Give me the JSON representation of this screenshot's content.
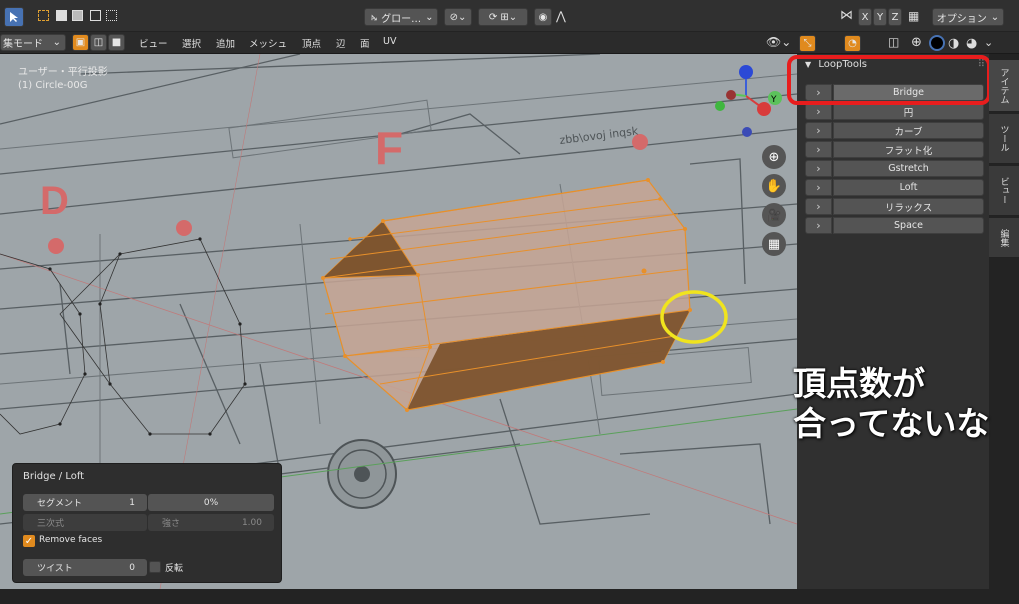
{
  "header": {
    "orientation_label": "グロー…",
    "options_label": "オプション",
    "axes": [
      "X",
      "Y",
      "Z"
    ]
  },
  "secondary": {
    "mode_label": "集モード",
    "menus": [
      "ビュー",
      "選択",
      "追加",
      "メッシュ",
      "頂点",
      "辺",
      "面",
      "UV"
    ]
  },
  "viewport": {
    "view_name": "ユーザー・平行投影",
    "object_name": "(1) Circle-00G",
    "bg_letters": [
      "D",
      "F"
    ],
    "blueprint_text": "zbb\\ovoj inqsk",
    "gizmo_labels": [
      "Y",
      "Z"
    ]
  },
  "sidebar": {
    "panel_title": "LoopTools",
    "buttons": [
      "Bridge",
      "円",
      "カーブ",
      "フラット化",
      "Gstretch",
      "Loft",
      "リラックス",
      "Space"
    ],
    "tabs": [
      "アイテム",
      "ツール",
      "ビュー",
      "編集"
    ]
  },
  "redo_panel": {
    "title": "Bridge / Loft",
    "segments_label": "セグメント",
    "segments_value": "1",
    "percent_value": "0%",
    "cubic_label": "三次式",
    "strength_label": "強さ",
    "strength_value": "1.00",
    "remove_faces_label": "Remove faces",
    "remove_faces_checked": true,
    "twist_label": "ツイスト",
    "twist_value": "0",
    "reverse_label": "反転"
  },
  "annotation": {
    "line1": "頂点数が",
    "line2": "合ってないな"
  },
  "colors": {
    "accent": "#4772b3",
    "highlight_red": "#e81d1d",
    "highlight_yellow": "#f0e41e",
    "mesh_edge": "#e8902a"
  }
}
